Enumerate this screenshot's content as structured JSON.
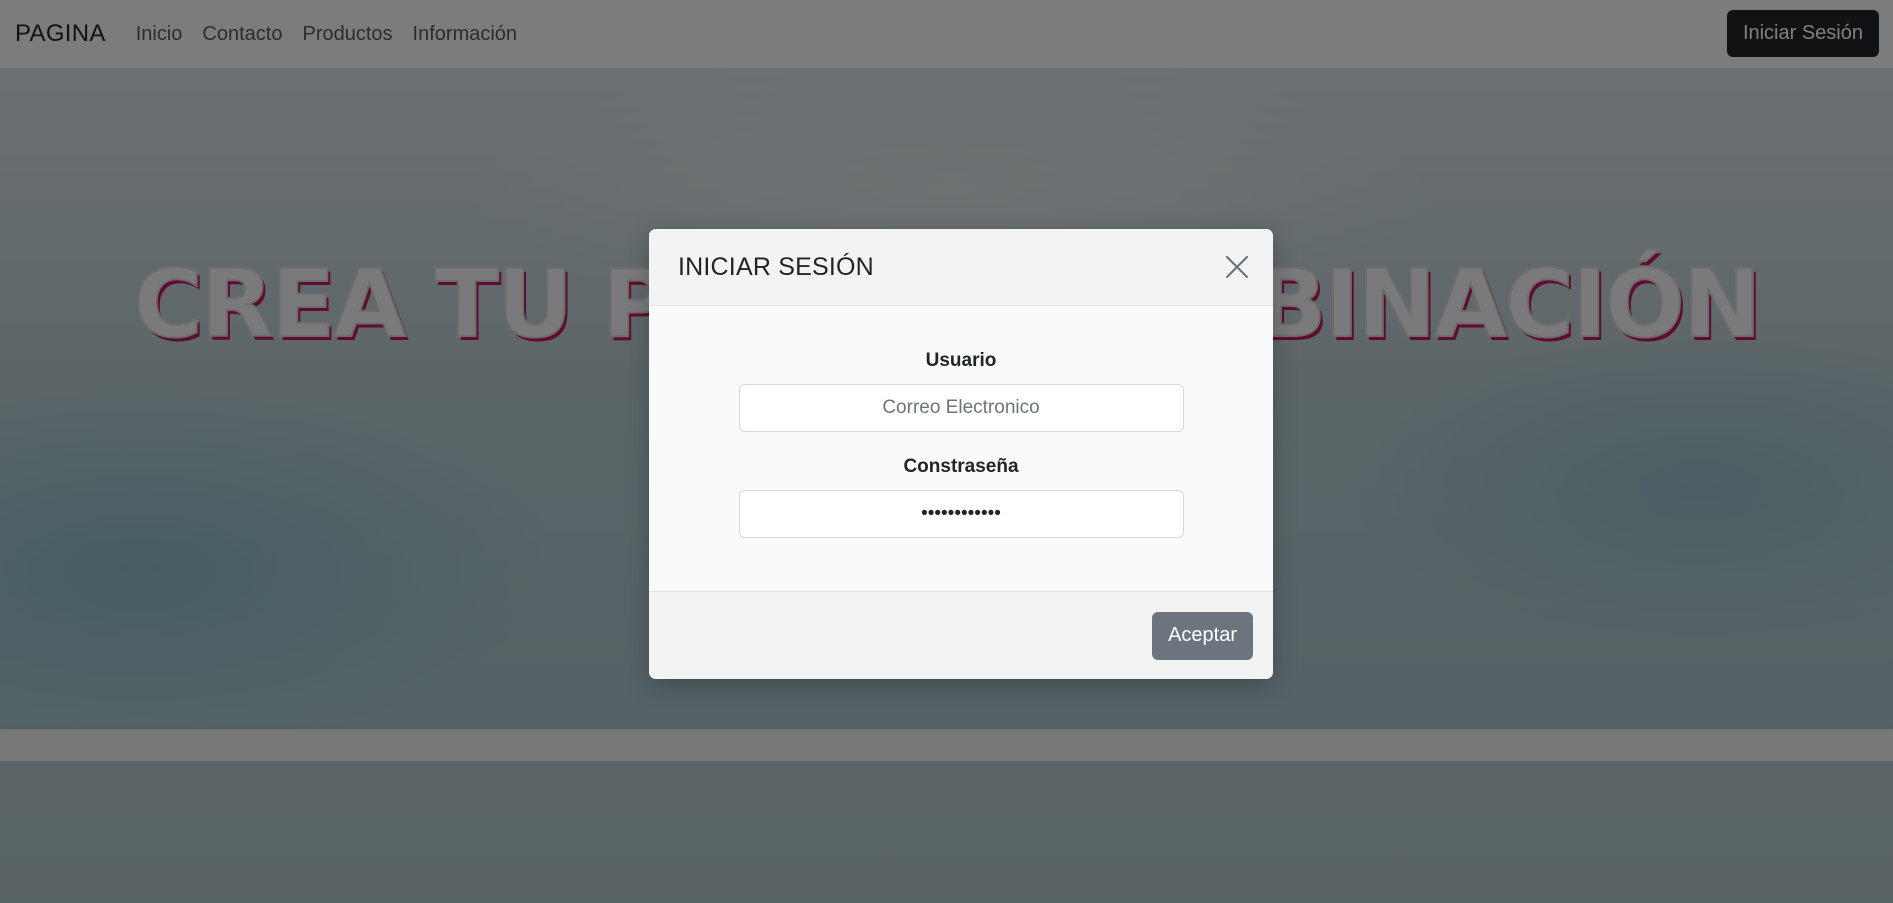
{
  "navbar": {
    "brand": "PAGINA",
    "links": [
      "Inicio",
      "Contacto",
      "Productos",
      "Información"
    ],
    "login_button": "Iniciar Sesión"
  },
  "hero": {
    "title": "CREA TU PROPIA COMBINACIÓN"
  },
  "modal": {
    "title": "INICIAR SESIÓN",
    "close_icon": "close-icon",
    "username": {
      "label": "Usuario",
      "placeholder": "Correo Electronico",
      "value": ""
    },
    "password": {
      "label": "Constraseña",
      "value": "••••••••••••"
    },
    "accept_button": "Aceptar"
  },
  "colors": {
    "navbar_bg": "#f8f9fa",
    "dark_button": "#212529",
    "accept_button": "#6c757d",
    "hero_title_shadow": "#c2185b"
  }
}
